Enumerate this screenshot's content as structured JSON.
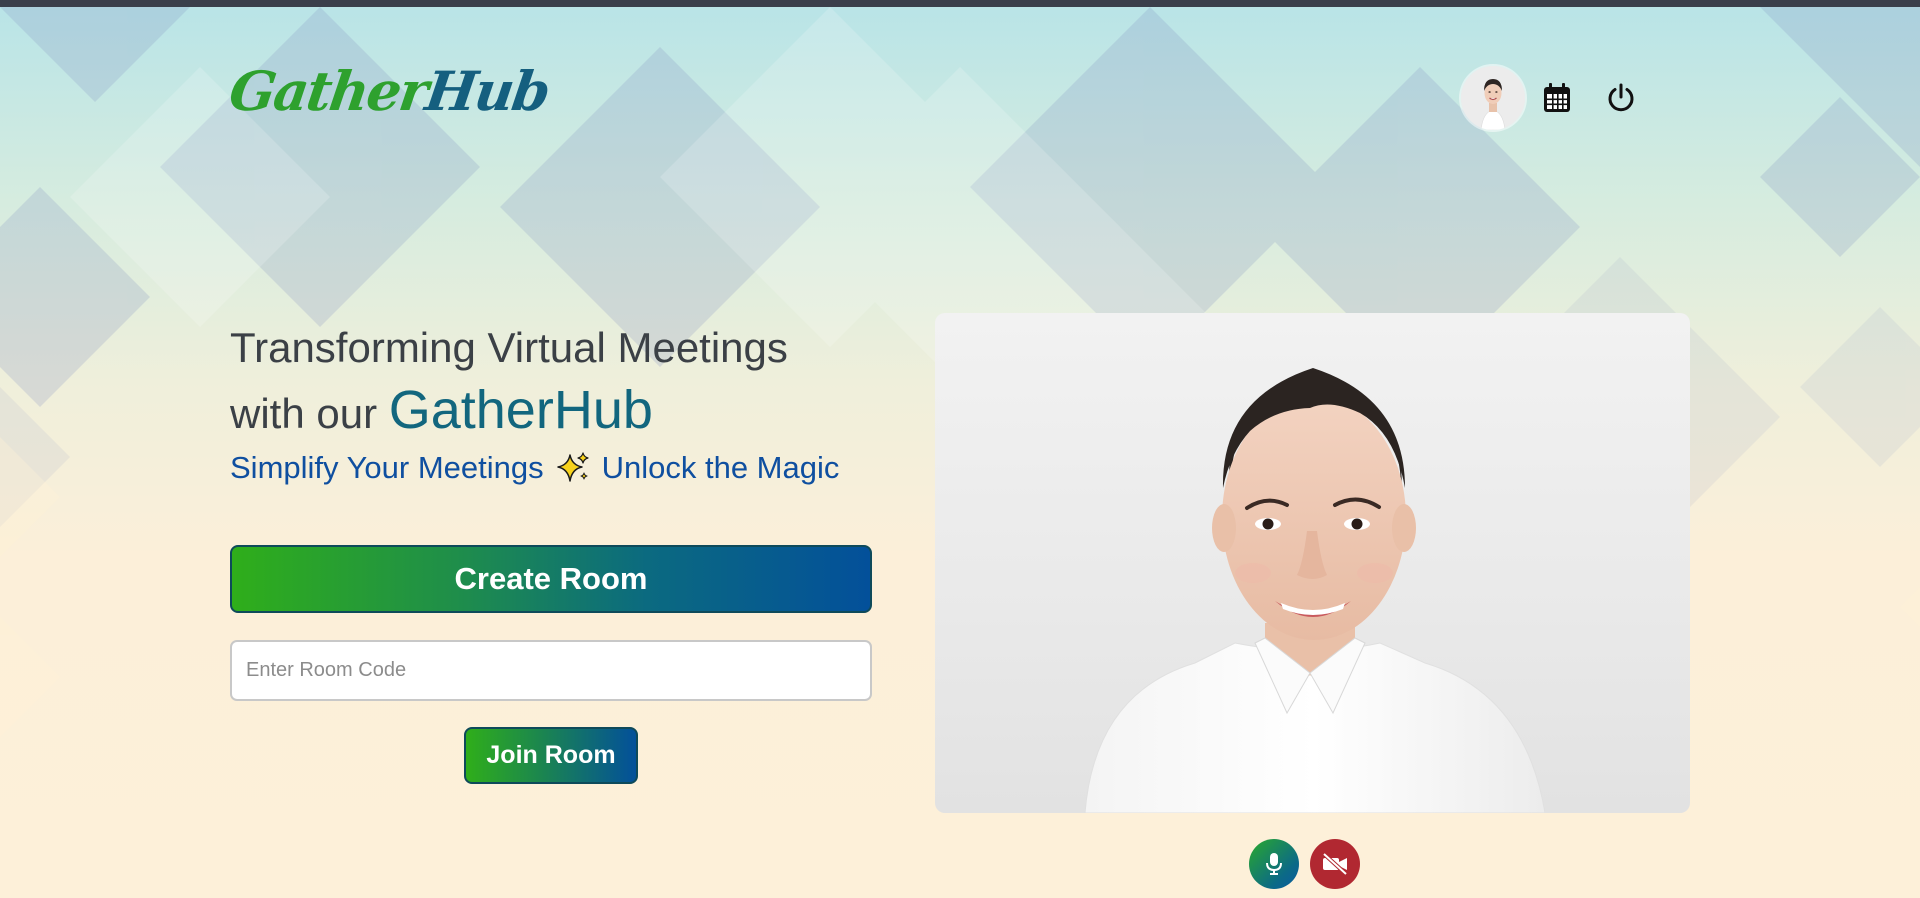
{
  "header": {
    "logo_part1": "Gather",
    "logo_part2": "Hub",
    "icons": [
      "avatar",
      "calendar-icon",
      "power-icon"
    ]
  },
  "hero": {
    "title_line1": "Transforming Virtual Meetings",
    "title_line2_prefix": "with our",
    "title_brand": "GatherHub",
    "tagline_left": "Simplify Your Meetings",
    "tagline_right": "Unlock the Magic",
    "tagline_icon": "sparkles-icon"
  },
  "actions": {
    "create_label": "Create Room",
    "room_code_placeholder": "Enter Room Code",
    "room_code_value": "",
    "join_label": "Join Room"
  },
  "preview": {
    "controls": [
      "microphone-icon",
      "video-off-icon"
    ]
  },
  "colors": {
    "brand_green": "#2fae1a",
    "brand_blue": "#03509a",
    "brand_teal": "#12667e",
    "tagline_blue": "#0f4fa0",
    "camera_off_red": "#b12831"
  }
}
